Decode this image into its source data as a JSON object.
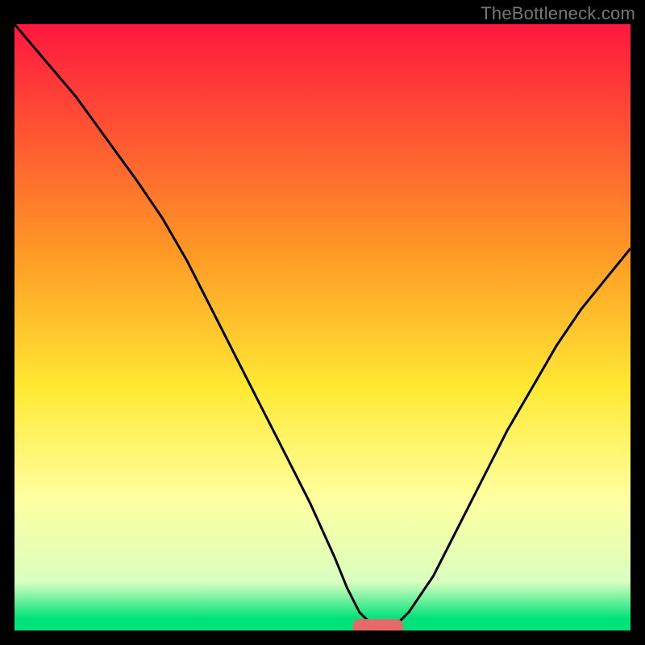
{
  "watermark": "TheBottleneck.com",
  "colors": {
    "frame": "#000000",
    "grad_top": "#ff173f",
    "grad_yellow": "#ffe933",
    "grad_lightyellow": "#ffff9e",
    "grad_green": "#00e27a",
    "curve": "#000000",
    "marker_fill": "#e76a6a",
    "marker_edge": "#e76a6a"
  },
  "chart_data": {
    "type": "line",
    "title": "",
    "xlabel": "",
    "ylabel": "",
    "xlim": [
      0,
      100
    ],
    "ylim": [
      0,
      100
    ],
    "series": [
      {
        "name": "bottleneck-curve",
        "x": [
          0,
          5,
          10,
          15,
          20,
          24,
          28,
          32,
          36,
          40,
          44,
          48,
          52,
          54,
          56,
          58,
          60,
          62,
          64,
          68,
          72,
          76,
          80,
          84,
          88,
          92,
          96,
          100
        ],
        "y": [
          100,
          94,
          88,
          81,
          74,
          68,
          61,
          53,
          45,
          37,
          29,
          21,
          12,
          7,
          3,
          1,
          0,
          1,
          3,
          9,
          17,
          25,
          33,
          40,
          47,
          53,
          58,
          63
        ]
      }
    ],
    "marker": {
      "name": "optimal-range",
      "x_center": 59,
      "y": 0.6,
      "width": 8,
      "height": 2.4
    },
    "gradient_stops": [
      {
        "offset": 0,
        "color": "#ff173f"
      },
      {
        "offset": 38,
        "color": "#ff9a25"
      },
      {
        "offset": 60,
        "color": "#ffe933"
      },
      {
        "offset": 78,
        "color": "#ffff9e"
      },
      {
        "offset": 92,
        "color": "#d9ffc0"
      },
      {
        "offset": 98,
        "color": "#00e27a"
      },
      {
        "offset": 100,
        "color": "#00e27a"
      }
    ]
  }
}
